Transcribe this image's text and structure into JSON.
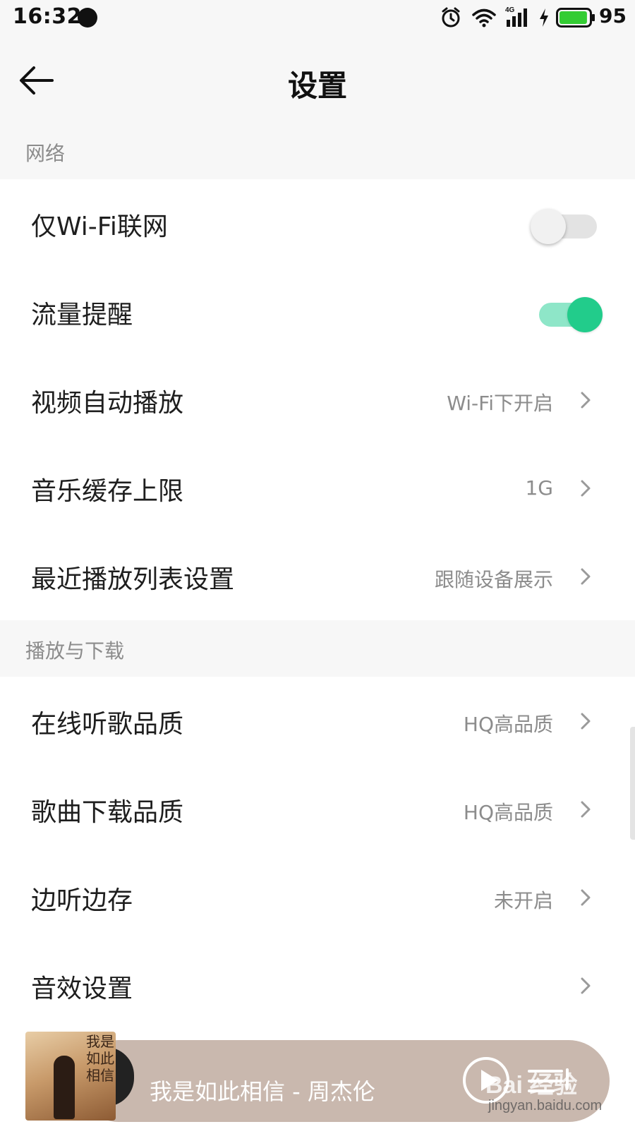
{
  "status_bar": {
    "time": "16:32",
    "network_type": "4G",
    "battery_level": "95",
    "battery_color": "#33cc33"
  },
  "header": {
    "title": "设置",
    "back_icon": "arrow-left-icon"
  },
  "sections": {
    "network": {
      "title": "网络",
      "items": [
        {
          "label": "仅Wi-Fi联网",
          "control": "toggle",
          "enabled": false
        },
        {
          "label": "流量提醒",
          "control": "toggle",
          "enabled": true
        },
        {
          "label": "视频自动播放",
          "value": "Wi-Fi下开启"
        },
        {
          "label": "音乐缓存上限",
          "value": "1G"
        },
        {
          "label": "最近播放列表设置",
          "value": "跟随设备展示"
        }
      ]
    },
    "playback": {
      "title": "播放与下载",
      "items": [
        {
          "label": "在线听歌品质",
          "value": "HQ高品质"
        },
        {
          "label": "歌曲下载品质",
          "value": "HQ高品质"
        },
        {
          "label": "边听边存",
          "value": "未开启"
        },
        {
          "label": "音效设置",
          "value": ""
        }
      ]
    }
  },
  "player": {
    "song": "我是如此相信 - 周杰伦",
    "album_art_text": "我是如此相信",
    "play_icon": "play-icon",
    "playlist_icon": "playlist-icon"
  },
  "watermark": {
    "text": "Bai 经验",
    "sub": "jingyan.baidu.com"
  },
  "colors": {
    "accent": "#22cc8b",
    "toggle_track_on": "#8ee6c8",
    "section_background": "#f7f7f7",
    "secondary_text": "#8c8c8c",
    "player_bar": "#c9b8ae"
  }
}
